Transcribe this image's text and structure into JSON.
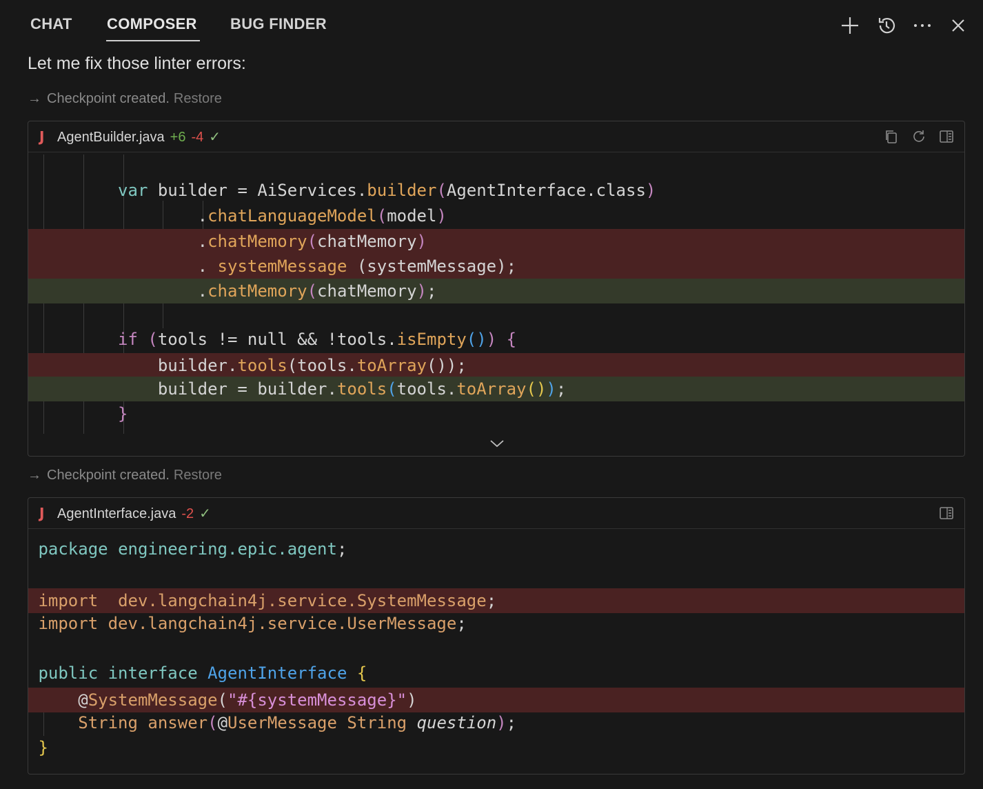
{
  "tabs": [
    {
      "label": "CHAT"
    },
    {
      "label": "COMPOSER"
    },
    {
      "label": "BUG FINDER"
    }
  ],
  "toolbar": {
    "new_icon": "plus-icon",
    "history_icon": "history-icon",
    "more_icon": "ellipsis-icon",
    "close_icon": "close-icon"
  },
  "message": "Let me fix those linter errors:",
  "checkpoints": [
    {
      "text": "Checkpoint created.",
      "restore": "Restore"
    },
    {
      "text": "Checkpoint created.",
      "restore": "Restore"
    }
  ],
  "blocks": [
    {
      "file_icon": "J",
      "filename": "AgentBuilder.java",
      "added": "+6",
      "removed": "-4",
      "status": "✓",
      "icons": [
        "copy-icon",
        "reapply-icon",
        "open-file-icon"
      ]
    },
    {
      "file_icon": "J",
      "filename": "AgentInterface.java",
      "removed": "-2",
      "status": "✓",
      "icons": [
        "open-file-icon"
      ]
    }
  ],
  "colors": {
    "background": "#181818",
    "deleted_line": "#4a2222",
    "added_line": "#343a2a",
    "added_count": "#6fae4f",
    "removed_count": "#e0514d"
  }
}
